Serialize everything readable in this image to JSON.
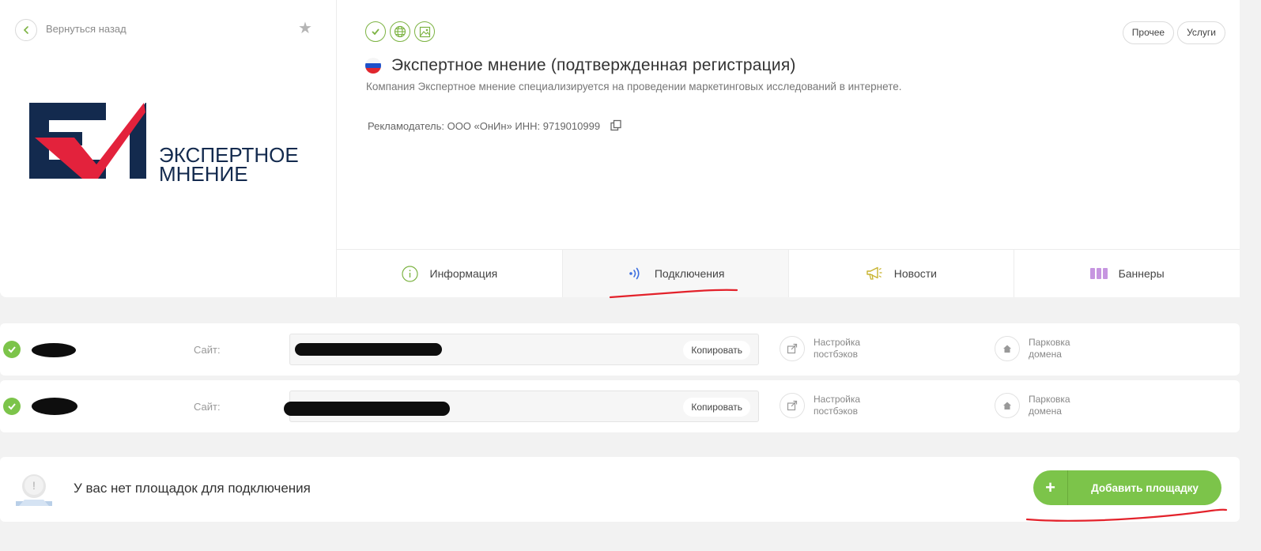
{
  "nav": {
    "back_label": "Вернуться назад"
  },
  "logo": {
    "line1": "ЭКСПЕРТНОЕ",
    "line2": "МНЕНИЕ"
  },
  "header": {
    "pills": [
      "Прочее",
      "Услуги"
    ],
    "title": "Экспертное мнение (подтвержденная регистрация)",
    "description": "Компания Экспертное мнение специализируется на проведении маркетинговых исследований в интернете.",
    "advertiser": "Рекламодатель: ООО «ОнИн» ИНН: 9719010999"
  },
  "tabs": [
    {
      "label": "Информация",
      "icon": "info-icon"
    },
    {
      "label": "Подключения",
      "icon": "signal-icon",
      "active": true
    },
    {
      "label": "Новости",
      "icon": "megaphone-icon"
    },
    {
      "label": "Баннеры",
      "icon": "banners-icon"
    }
  ],
  "connections": [
    {
      "site_label": "Сайт:",
      "copy_label": "Копировать",
      "postback_label": "Настройка постбэков",
      "parking_label": "Парковка домена"
    },
    {
      "site_label": "Сайт:",
      "copy_label": "Копировать",
      "postback_label": "Настройка постбэков",
      "parking_label": "Парковка домена"
    }
  ],
  "bottom": {
    "message": "У вас нет площадок для подключения",
    "add_button": "Добавить площадку",
    "add_icon": "+"
  },
  "colors": {
    "accent": "#7cc44a",
    "brand_navy": "#132a4e",
    "brand_red": "#e3223c",
    "annotation": "#e3222b"
  }
}
